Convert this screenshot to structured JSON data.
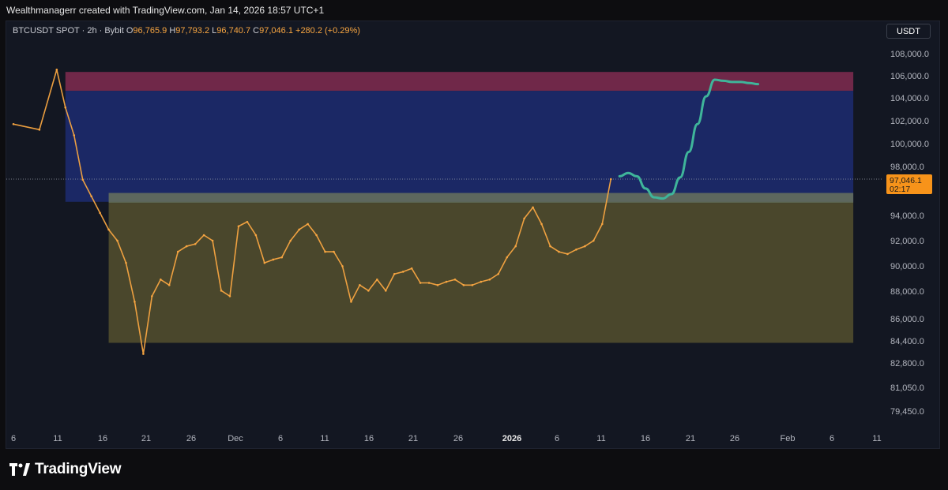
{
  "credit": "Wealthmanagerr created with TradingView.com, Jan 14, 2026 18:57 UTC+1",
  "legend": {
    "symbol": "BTCUSDT SPOT · 2h · Bybit",
    "open_label": "O",
    "open": "96,765.9",
    "high_label": "H",
    "high": "97,793.2",
    "low_label": "L",
    "low": "96,740.7",
    "close_label": "C",
    "close": "97,046.1",
    "change": "+280.2 (+0.29%)"
  },
  "unit": "USDT",
  "price_tag": {
    "price": "97,046.1",
    "countdown": "02:17"
  },
  "logo": {
    "text": "TradingView"
  },
  "colors": {
    "background": "#131722",
    "candle": "#f7a541",
    "zone_top": "#8b2d55",
    "zone_blue": "#1e2d78",
    "zone_gold": "#5a5530",
    "projection": "#3fb59a",
    "price_tag": "#f7931a"
  },
  "chart_data": {
    "type": "line",
    "series": [
      {
        "role": "price-history",
        "x": [
          "Nov 6",
          "Nov 9",
          "Nov 11",
          "Nov 12",
          "Nov 13",
          "Nov 14",
          "Nov 15",
          "Nov 16",
          "Nov 17",
          "Nov 18",
          "Nov 19",
          "Nov 20",
          "Nov 21",
          "Nov 22",
          "Nov 23",
          "Nov 24",
          "Nov 25",
          "Nov 26",
          "Nov 27",
          "Nov 28",
          "Nov 29",
          "Nov 30",
          "Dec 1",
          "Dec 2",
          "Dec 3",
          "Dec 4",
          "Dec 5",
          "Dec 6",
          "Dec 7",
          "Dec 8",
          "Dec 9",
          "Dec 10",
          "Dec 11",
          "Dec 12",
          "Dec 13",
          "Dec 14",
          "Dec 15",
          "Dec 16",
          "Dec 17",
          "Dec 18",
          "Dec 19",
          "Dec 20",
          "Dec 21",
          "Dec 22",
          "Dec 23",
          "Dec 24",
          "Dec 25",
          "Dec 26",
          "Dec 27",
          "Dec 28",
          "Dec 29",
          "Dec 30",
          "Dec 31",
          "Jan 1",
          "Jan 2",
          "Jan 3",
          "Jan 4",
          "Jan 5",
          "Jan 6",
          "Jan 7",
          "Jan 8",
          "Jan 9",
          "Jan 10",
          "Jan 11",
          "Jan 12",
          "Jan 13",
          "Jan 14"
        ],
        "values": [
          102000,
          101500,
          106900,
          103500,
          101000,
          97000,
          95500,
          94000,
          92500,
          91500,
          89500,
          86000,
          81300,
          86500,
          88000,
          87500,
          90500,
          91000,
          91200,
          92000,
          91500,
          87000,
          86500,
          92800,
          93200,
          92000,
          89500,
          89800,
          90000,
          91500,
          92500,
          93000,
          92000,
          90500,
          90500,
          89200,
          86000,
          87500,
          87000,
          88000,
          87000,
          88500,
          88700,
          89000,
          87700,
          87700,
          87500,
          87800,
          88000,
          87500,
          87500,
          87800,
          88000,
          88500,
          90000,
          91000,
          93500,
          94500,
          93000,
          91000,
          90500,
          90300,
          90700,
          91000,
          91500,
          93000,
          97046
        ]
      },
      {
        "role": "projection",
        "x": [
          "Jan 15",
          "Jan 16",
          "Jan 17",
          "Jan 18",
          "Jan 19",
          "Jan 20",
          "Jan 21",
          "Jan 22",
          "Jan 23",
          "Jan 24",
          "Jan 25",
          "Jan 26",
          "Jan 27",
          "Jan 28",
          "Jan 29",
          "Jan 30",
          "Jan 31"
        ],
        "values": [
          97300,
          97600,
          97300,
          96200,
          95400,
          95300,
          95700,
          97200,
          99500,
          102000,
          104500,
          106000,
          105900,
          105800,
          105800,
          105700,
          105600
        ]
      }
    ],
    "zones": [
      {
        "from_x": "Nov 12",
        "to_x": "Feb 11",
        "low": 105000,
        "high": 106700,
        "color": "#8b2d55"
      },
      {
        "from_x": "Nov 12",
        "to_x": "Feb 11",
        "low": 95000,
        "high": 105000,
        "color": "#1e2d78"
      },
      {
        "from_x": "Nov 17",
        "to_x": "Feb 11",
        "low": 94900,
        "high": 95800,
        "color": "#6f7a5c"
      },
      {
        "from_x": "Nov 17",
        "to_x": "Feb 11",
        "low": 82300,
        "high": 94900,
        "color": "#5a5530"
      }
    ],
    "yticks": [
      "108,000.0",
      "106,000.0",
      "104,000.0",
      "102,000.0",
      "100,000.0",
      "98,000.0",
      "94,000.0",
      "92,000.0",
      "90,000.0",
      "88,000.0",
      "86,000.0",
      "84,400.0",
      "82,800.0",
      "81,050.0",
      "79,450.0"
    ],
    "xticks": [
      "6",
      "11",
      "16",
      "21",
      "26",
      "Dec",
      "6",
      "11",
      "16",
      "21",
      "26",
      "2026",
      "6",
      "11",
      "16",
      "21",
      "26",
      "Feb",
      "6",
      "11"
    ],
    "last_price": 97046.1
  }
}
